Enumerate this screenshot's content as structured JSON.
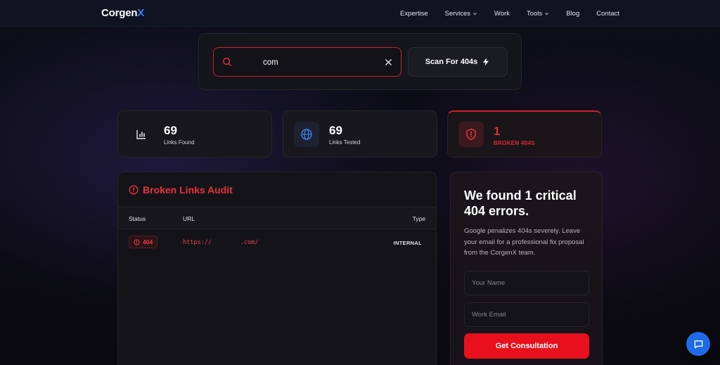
{
  "brand": {
    "name_main": "Corgen",
    "name_accent": "X",
    "accent_color": "#3b82f6"
  },
  "nav": {
    "items": [
      {
        "label": "Expertise",
        "has_dropdown": false
      },
      {
        "label": "Services",
        "has_dropdown": true
      },
      {
        "label": "Work",
        "has_dropdown": false
      },
      {
        "label": "Tools",
        "has_dropdown": true
      },
      {
        "label": "Blog",
        "has_dropdown": false
      },
      {
        "label": "Contact",
        "has_dropdown": false
      }
    ]
  },
  "search": {
    "value": "com",
    "icon": "search-icon",
    "clear_icon": "close-icon",
    "button_label": "Scan For 404s",
    "button_icon": "lightning-icon"
  },
  "stats": [
    {
      "value": "69",
      "label": "Links Found",
      "icon": "bar-chart-icon"
    },
    {
      "value": "69",
      "label": "Links Tested",
      "icon": "globe-icon"
    },
    {
      "value": "1",
      "label": "BROKEN 404S",
      "icon": "shield-alert-icon",
      "color": "#e62b35"
    }
  ],
  "audit": {
    "title": "Broken Links Audit",
    "columns": {
      "status": "Status",
      "url": "URL",
      "type": "Type"
    },
    "rows": [
      {
        "status": "404",
        "url": "https://        .com/",
        "type": "INTERNAL"
      }
    ]
  },
  "lead": {
    "title": "We found 1 critical 404 errors.",
    "description": "Google penalizes 404s severely. Leave your email for a professional fix proposal from the CorgenX team.",
    "name_placeholder": "Your Name",
    "email_placeholder": "Work Email",
    "cta_label": "Get Consultation",
    "cta_color": "#e8101c"
  },
  "chat": {
    "icon": "chat-bubble-icon",
    "color": "#1e6be6"
  }
}
